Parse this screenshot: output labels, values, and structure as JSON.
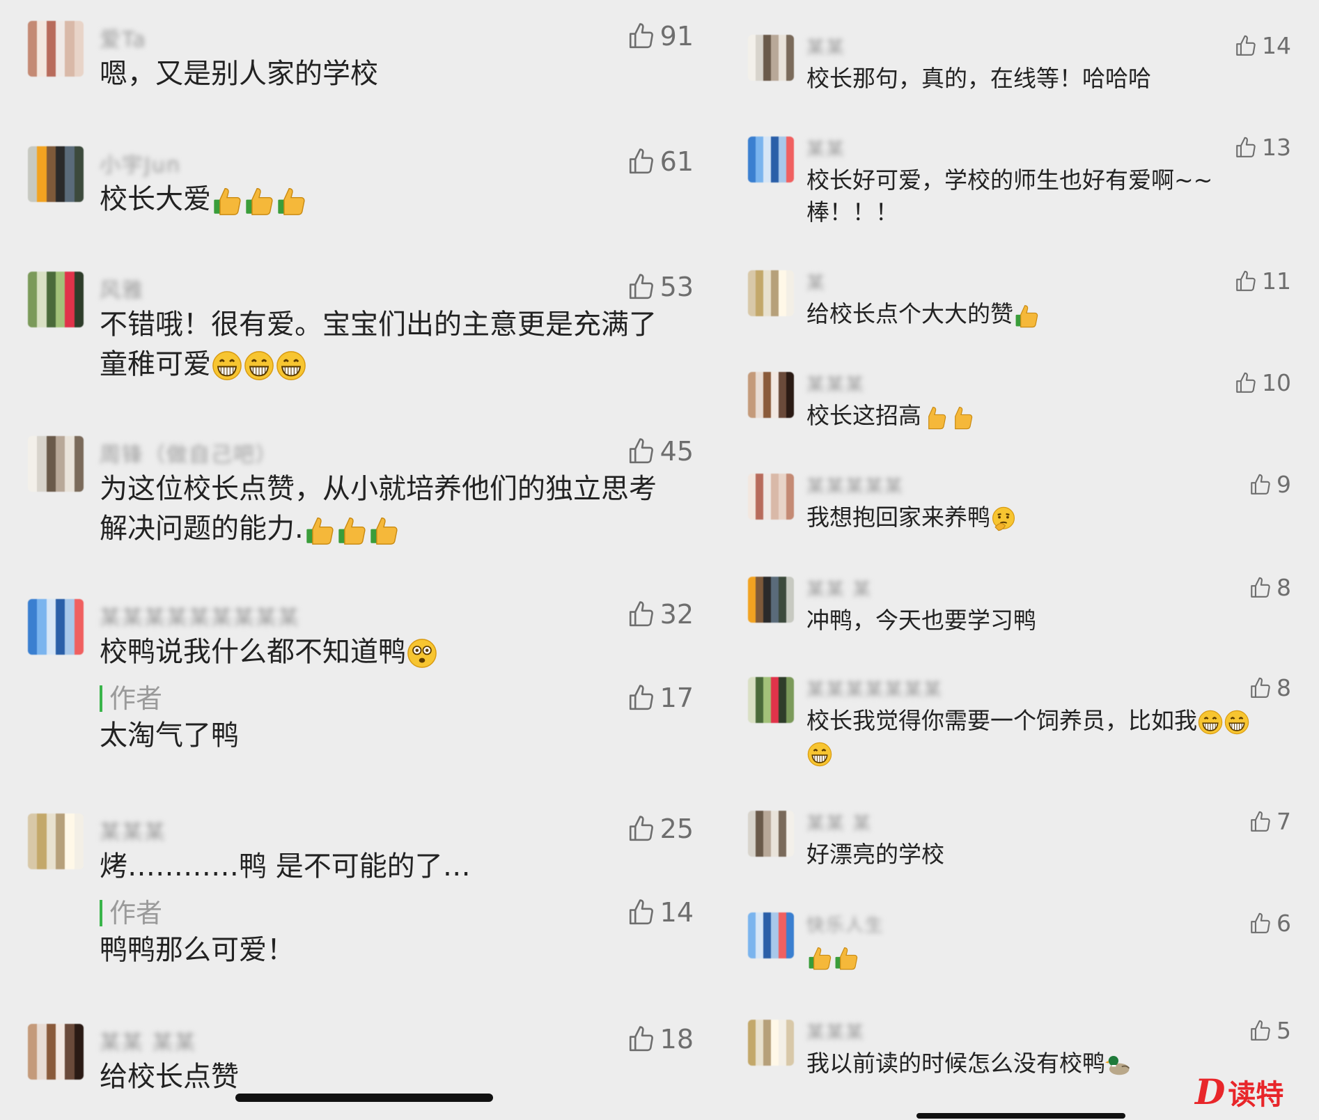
{
  "colors": {
    "background": "#ededed",
    "text": "#222222",
    "like": "#6e6e6e",
    "nickname": "#9a9a9a",
    "author_tag_bar": "#39b54a",
    "watermark": "#e8262a"
  },
  "left": {
    "comments": [
      {
        "nickname": "爱Ta",
        "text": "嗯，又是别人家的学校",
        "likes": "91",
        "emoji": []
      },
      {
        "nickname": "小宇Jun",
        "text": "校长大爱",
        "likes": "61",
        "emoji": [
          "thumbs-up",
          "thumbs-up",
          "thumbs-up"
        ]
      },
      {
        "nickname": "风雅",
        "text_line1": "不错哦！很有爱。宝宝们出的主意更是充满了",
        "text_line2": "童稚可爱",
        "likes": "53",
        "emoji": [
          "grin",
          "grin",
          "grin"
        ]
      },
      {
        "nickname": "周锋（做自己吧）",
        "text_line1": "为这位校长点赞，从小就培养他们的独立思考",
        "text_line2": "解决问题的能力.",
        "likes": "45",
        "emoji": [
          "thumbs-up",
          "thumbs-up",
          "thumbs-up"
        ]
      },
      {
        "nickname": "某某某某某某某某某",
        "text": "校鸭说我什么都不知道鸭",
        "likes": "32",
        "emoji": [
          "dizzy"
        ],
        "reply": {
          "tag": "作者",
          "text": "太淘气了鸭",
          "likes": "17"
        }
      },
      {
        "nickname": "某某某",
        "text": "烤…………鸭 是不可能的了…",
        "likes": "25",
        "emoji": [],
        "reply": {
          "tag": "作者",
          "text": "鸭鸭那么可爱！",
          "likes": "14"
        }
      },
      {
        "nickname": "某某 某某",
        "text": "给校长点赞",
        "likes": "18",
        "emoji": []
      }
    ]
  },
  "right": {
    "comments": [
      {
        "nickname": "某某",
        "text": "校长那句，真的，在线等！哈哈哈",
        "likes": "14",
        "emoji": []
      },
      {
        "nickname": "某某",
        "text_line1": "校长好可爱，学校的师生也好有爱啊~~",
        "text_line2": "棒！！！",
        "likes": "13",
        "emoji": []
      },
      {
        "nickname": "某",
        "text": "给校长点个大大的赞",
        "likes": "11",
        "emoji": [
          "thumbs-up"
        ]
      },
      {
        "nickname": "某某某",
        "text": "校长这招高",
        "likes": "10",
        "emoji": [
          "thumbs-up-yellow",
          "thumbs-up-yellow"
        ]
      },
      {
        "nickname": "某某某某某",
        "text": "我想抱回家来养鸭",
        "likes": "9",
        "emoji": [
          "thinking"
        ]
      },
      {
        "nickname": "某某 某",
        "text": "冲鸭，今天也要学习鸭",
        "likes": "8",
        "emoji": []
      },
      {
        "nickname": "某某某某某某某",
        "text_line1": "校长我觉得你需要一个饲养员，比如我",
        "likes": "8",
        "emoji": [
          "grin",
          "grin",
          "grin"
        ]
      },
      {
        "nickname": "某某 某",
        "text": "好漂亮的学校",
        "likes": "7",
        "emoji": []
      },
      {
        "nickname": "快乐人生",
        "text": "",
        "likes": "6",
        "emoji": [
          "thumbs-up",
          "thumbs-up"
        ]
      },
      {
        "nickname": "某某某",
        "text": "我以前读的时候怎么没有校鸭",
        "likes": "5",
        "emoji": [
          "duck"
        ]
      }
    ]
  },
  "watermark": {
    "logo": "D",
    "text": "读特"
  }
}
